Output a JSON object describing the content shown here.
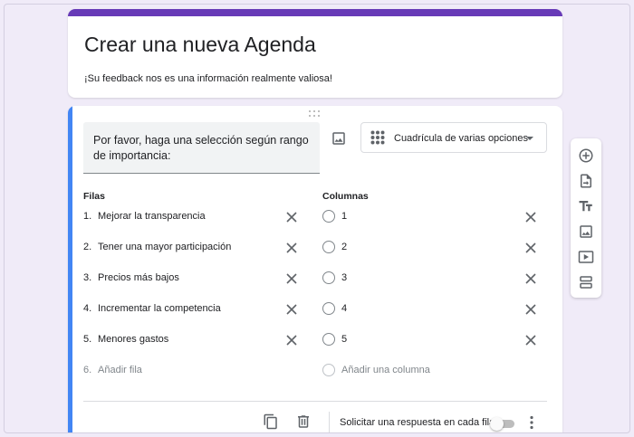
{
  "header": {
    "title": "Crear una nueva Agenda",
    "description": "¡Su feedback nos es una información realmente valiosa!",
    "accent_color": "#673ab7"
  },
  "question": {
    "text": "Por favor, haga una selección según rango de importancia:",
    "type_label": "Cuadrícula de varias opciones",
    "type_icon": "grid-dots-icon",
    "image_icon": "image-icon",
    "active_bar_color": "#4285f4",
    "rows_header": "Filas",
    "columns_header": "Columnas",
    "rows": [
      {
        "num": "1.",
        "label": "Mejorar la transparencia"
      },
      {
        "num": "2.",
        "label": "Tener una mayor participación"
      },
      {
        "num": "3.",
        "label": "Precios más bajos"
      },
      {
        "num": "4.",
        "label": "Incrementar la competencia"
      },
      {
        "num": "5.",
        "label": "Menores gastos"
      }
    ],
    "add_row": {
      "num": "6.",
      "label": "Añadir fila"
    },
    "columns": [
      {
        "label": "1"
      },
      {
        "label": "2"
      },
      {
        "label": "3"
      },
      {
        "label": "4"
      },
      {
        "label": "5"
      }
    ],
    "add_column": {
      "label": "Añadir una columna"
    }
  },
  "footer": {
    "duplicate_icon": "copy-icon",
    "delete_icon": "trash-icon",
    "require_label": "Solicitar una respuesta en cada fila",
    "require_enabled": false,
    "more_icon": "more-vert-icon"
  },
  "toolbar": {
    "items": [
      {
        "name": "add-question",
        "icon": "plus-circle-icon"
      },
      {
        "name": "import-questions",
        "icon": "import-icon"
      },
      {
        "name": "add-title",
        "icon": "title-icon"
      },
      {
        "name": "add-image",
        "icon": "image-icon"
      },
      {
        "name": "add-video",
        "icon": "video-icon"
      },
      {
        "name": "add-section",
        "icon": "section-icon"
      }
    ]
  }
}
